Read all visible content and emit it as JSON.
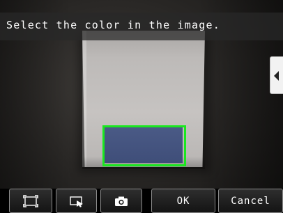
{
  "instruction": "Select the color in the image.",
  "side_tab": {
    "icon": "chevron-left-icon"
  },
  "toolbar": {
    "frame_icon": "fit-frame-icon",
    "select_icon": "region-select-icon",
    "capture_icon": "camera-icon",
    "ok_label": "OK",
    "cancel_label": "Cancel"
  },
  "colors": {
    "roi_border": "#19e81f",
    "swatch": "#445382",
    "banner": "#282828"
  }
}
